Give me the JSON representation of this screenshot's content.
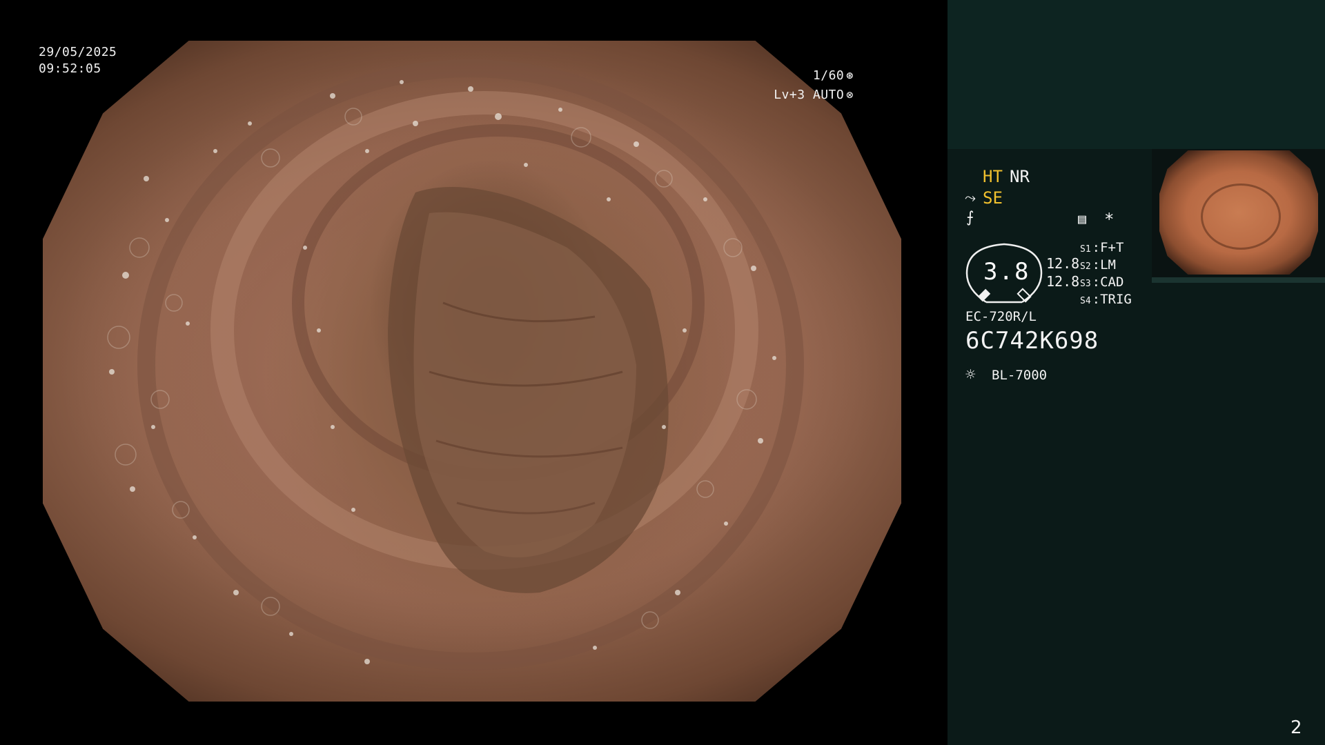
{
  "overlay": {
    "date": "29/05/2025",
    "time": "09:52:05",
    "shutter": "1/60",
    "shutter_icon": "aperture-icon",
    "level": "Lv+3 AUTO",
    "level_icon": "iris-icon"
  },
  "panel": {
    "ht": "HT",
    "nr": "NR",
    "se_icon": "scope-bend-icon",
    "se": "SE",
    "curve_icon": "curve-icon",
    "menu_icon": "image-menu-icon",
    "asterisk": "*",
    "dial_value": "3.8",
    "gain_1": "12.8",
    "gain_2": "12.8",
    "switches": [
      {
        "key": "S1",
        "label": "F+T"
      },
      {
        "key": "S2",
        "label": "LM"
      },
      {
        "key": "S3",
        "label": "CAD"
      },
      {
        "key": "S4",
        "label": "TRIG"
      }
    ],
    "scope_model": "EC-720R/L",
    "serial": "6C742K698",
    "light_icon": "light-source-icon",
    "light_model": "BL-7000"
  },
  "page_number": "2",
  "colors": {
    "highlight_yellow": "#f2c12e",
    "panel_bg": "#0b1a18",
    "panel_top_bg": "#0d2421",
    "mucosa": "#a8785f"
  }
}
